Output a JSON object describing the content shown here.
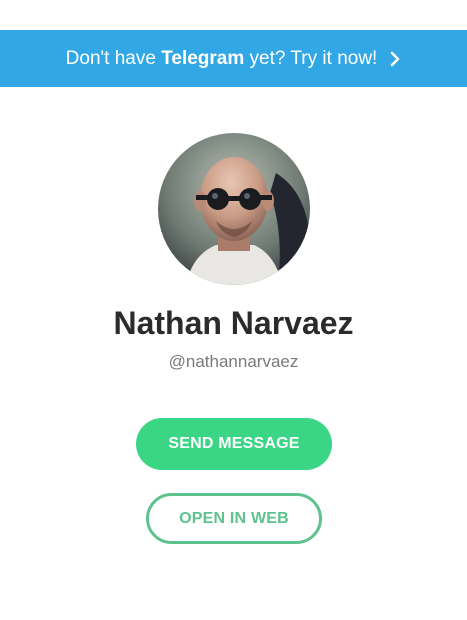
{
  "banner": {
    "text_before": "Don't have ",
    "brand": "Telegram",
    "text_after": " yet? Try it now!",
    "icon": "chevron-right-icon"
  },
  "profile": {
    "name": "Nathan Narvaez",
    "username": "@nathannarvaez",
    "avatar_icon": "user-photo"
  },
  "actions": {
    "send_label": "SEND MESSAGE",
    "web_label": "OPEN IN WEB"
  },
  "colors": {
    "banner_bg": "#32a7e6",
    "primary_green": "#3bd586",
    "outline_green": "#5ec28d",
    "name_text": "#2b2b2b",
    "username_text": "#7a7a7a"
  }
}
